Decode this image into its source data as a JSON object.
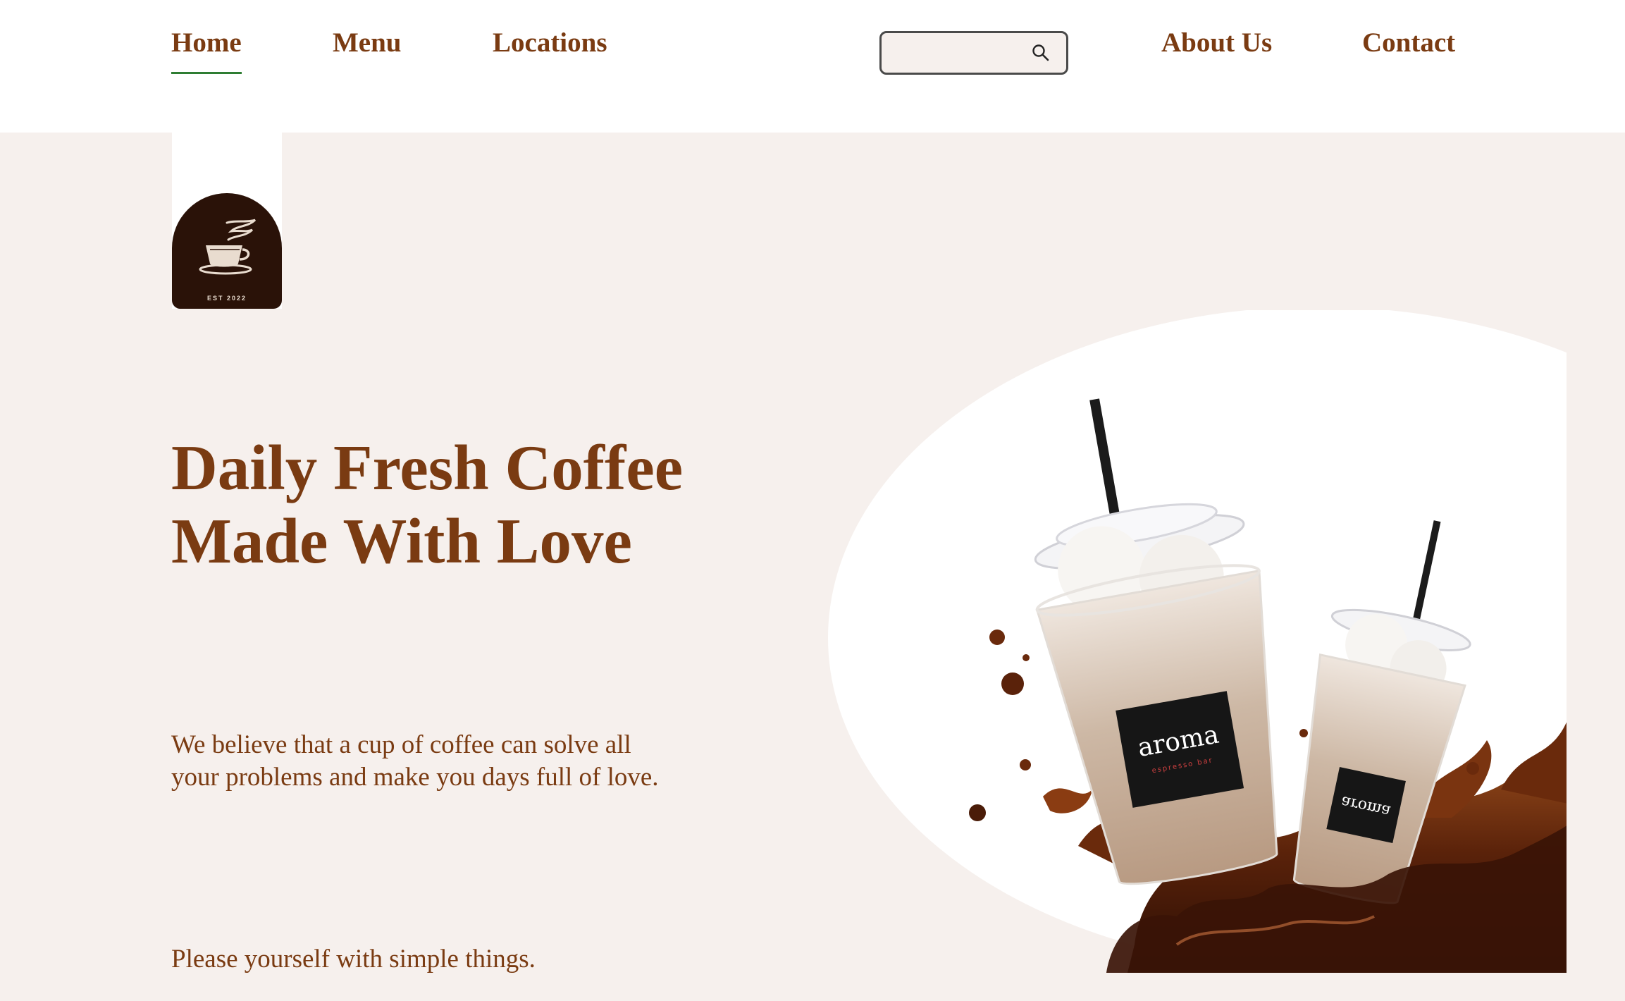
{
  "nav": {
    "items": [
      {
        "label": "Home",
        "active": true
      },
      {
        "label": "Menu",
        "active": false
      },
      {
        "label": "Locations",
        "active": false
      }
    ],
    "right_items": [
      {
        "label": "About Us"
      },
      {
        "label": "Contact"
      }
    ],
    "search": {
      "placeholder": "",
      "value": "",
      "icon": "search-icon"
    }
  },
  "logo": {
    "icon": "coffee-cup-icon",
    "text": "EST 2022"
  },
  "hero": {
    "headline_line1": "Daily Fresh Coffee",
    "headline_line2": "Made With Love",
    "tagline_line1": "We believe that a cup of coffee can solve all",
    "tagline_line2": "your problems and make you days full of love.",
    "subline": "Please yourself with simple things.",
    "cup_label_front": "aroma",
    "cup_sublabel": "espresso bar",
    "cup_label_back": "aroma"
  },
  "colors": {
    "brand_brown": "#7a3b12",
    "hero_background": "#f6f0ed",
    "logo_background": "#2a1208",
    "active_underline": "#2e7d32",
    "coffee": "#4a1c08"
  }
}
